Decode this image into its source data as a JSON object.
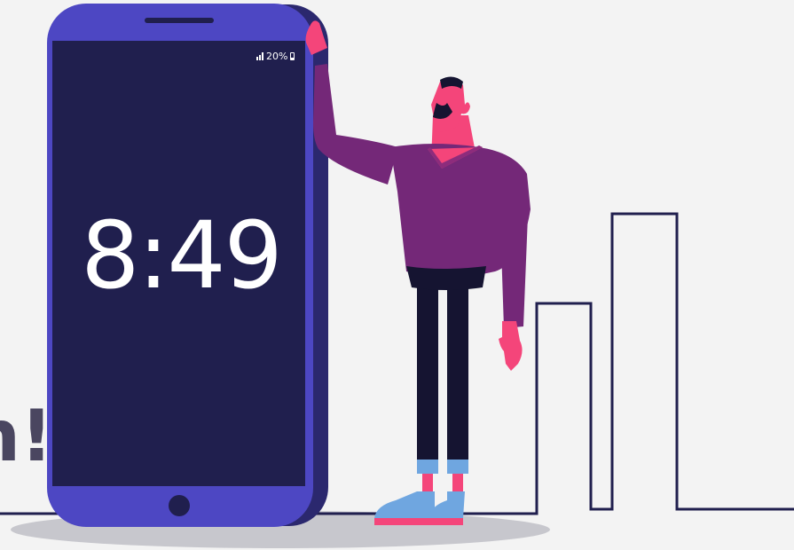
{
  "phone": {
    "time": "8:49",
    "battery": "20%",
    "icons": [
      "signal-icon",
      "battery-icon"
    ]
  },
  "partial_heading": "n!",
  "colors": {
    "background": "#f3f3f3",
    "phone_body": "#4d47c3",
    "phone_screen": "#201f4e",
    "skin": "#f4457a",
    "sweater": "#742878",
    "pants": "#151431",
    "shoes": "#6fa6e0",
    "line": "#201f4e"
  }
}
